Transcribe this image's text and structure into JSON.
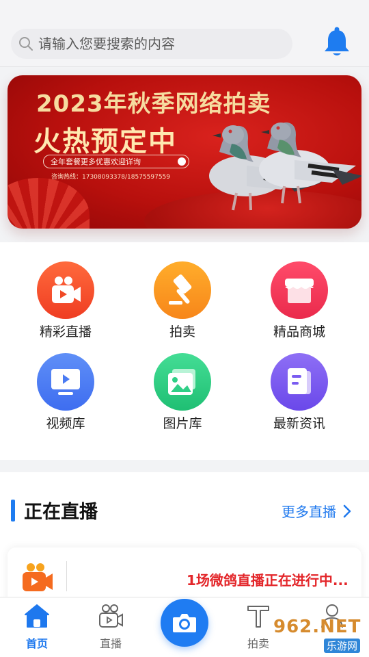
{
  "search": {
    "placeholder": "请输入您要搜索的内容"
  },
  "banner": {
    "title": "2023年秋季网络拍卖",
    "subtitle": "火热预定中",
    "pill": "全年套餐更多优惠欢迎详询",
    "hotline": "咨询热线：17308093378/18575597559"
  },
  "grid": [
    {
      "label": "精彩直播",
      "icon": "video-camera-icon",
      "color": "#f2512a"
    },
    {
      "label": "拍卖",
      "icon": "gavel-icon",
      "color": "#f79a1c"
    },
    {
      "label": "精品商城",
      "icon": "store-icon",
      "color": "#f03a5c"
    },
    {
      "label": "视频库",
      "icon": "monitor-icon",
      "color": "#4a7bf3"
    },
    {
      "label": "图片库",
      "icon": "image-icon",
      "color": "#2fcf86"
    },
    {
      "label": "最新资讯",
      "icon": "document-icon",
      "color": "#7a5cf0"
    }
  ],
  "live": {
    "title": "正在直播",
    "more": "更多直播",
    "status": "1场微鸽直播正在进行中..."
  },
  "tabbar": {
    "home": "首页",
    "live": "直播",
    "auction": "拍卖"
  },
  "watermark": {
    "text": "962.NET",
    "sub": "乐游网"
  },
  "colors": {
    "accent": "#1e78ee",
    "live_red": "#e3262a",
    "banner_red": "#c0140f"
  }
}
